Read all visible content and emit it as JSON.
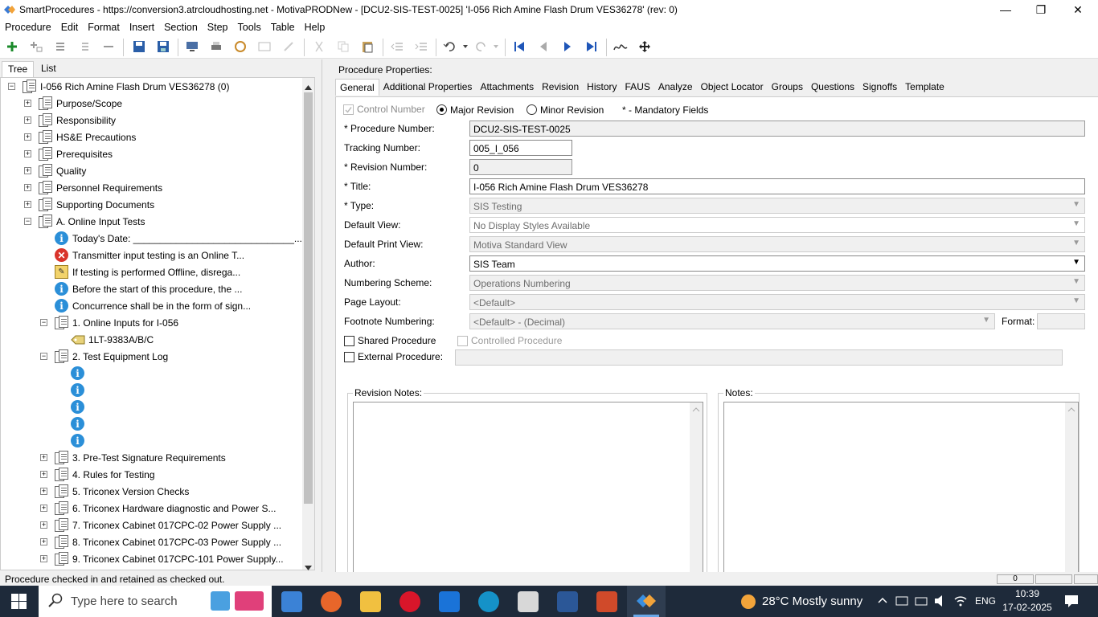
{
  "window": {
    "title": "SmartProcedures - https://conversion3.atrcloudhosting.net - MotivaPRODNew - [DCU2-SIS-TEST-0025] 'I-056 Rich Amine Flash Drum VES36278' (rev: 0)",
    "minimize": "—",
    "restore": "❐",
    "close": "✕"
  },
  "menu": [
    "Procedure",
    "Edit",
    "Format",
    "Insert",
    "Section",
    "Step",
    "Tools",
    "Table",
    "Help"
  ],
  "left_tabs": [
    "Tree",
    "List"
  ],
  "tree": {
    "root": "I-056 Rich Amine Flash Drum VES36278 (0)",
    "sections": [
      "Purpose/Scope",
      "Responsibility",
      "HS&E Precautions",
      "Prerequisites",
      "Quality",
      "Personnel Requirements",
      "Supporting Documents",
      "A. Online Input Tests"
    ],
    "online_children": [
      "Today's Date: ______________________________...",
      "Transmitter input testing is an Online T...",
      "If testing is performed Offline, disrega...",
      "Before the start of this procedure, the ...",
      "Concurrence shall be in the form of sign..."
    ],
    "sub1": "1. Online Inputs for I-056",
    "sub1_child": "1LT-9383A/B/C",
    "sub2": "2. Test Equipment Log",
    "later": [
      "3. Pre-Test Signature Requirements",
      "4. Rules for Testing",
      "5. Triconex Version Checks",
      "6. Triconex Hardware diagnostic and Power S...",
      "7. Triconex Cabinet 017CPC-02 Power Supply ...",
      "8. Triconex Cabinet 017CPC-03 Power Supply ...",
      "9. Triconex Cabinet 017CPC-101 Power Supply..."
    ],
    "expand_plus": "+",
    "expand_minus": "−",
    "info_glyph": "i",
    "err_glyph": "✕",
    "warn_glyph": "✎"
  },
  "props": {
    "heading": "Procedure Properties:",
    "tabs": [
      "General",
      "Additional Properties",
      "Attachments",
      "Revision",
      "History",
      "FAUS",
      "Analyze",
      "Object Locator",
      "Groups",
      "Questions",
      "Signoffs",
      "Template"
    ],
    "control_number": "Control Number",
    "major_revision": "Major Revision",
    "minor_revision": "Minor Revision",
    "mandatory": "* - Mandatory Fields",
    "procedure_number_label": "* Procedure Number:",
    "procedure_number": "DCU2-SIS-TEST-0025",
    "tracking_number_label": "Tracking Number:",
    "tracking_number": "005_I_056",
    "revision_number_label": "* Revision Number:",
    "revision_number": "0",
    "title_label": "* Title:",
    "title": "I-056 Rich Amine Flash Drum VES36278",
    "type_label": "* Type:",
    "type": "SIS Testing",
    "default_view_label": "Default View:",
    "default_view": "No Display Styles Available",
    "default_print_view_label": "Default Print View:",
    "default_print_view": "Motiva Standard View",
    "author_label": "Author:",
    "author": "SIS Team",
    "numbering_scheme_label": "Numbering Scheme:",
    "numbering_scheme": "Operations Numbering",
    "page_layout_label": "Page Layout:",
    "page_layout": "<Default>",
    "footnote_numbering_label": "Footnote Numbering:",
    "footnote_numbering": "<Default> - (Decimal)",
    "format_label": "Format:",
    "shared_procedure": "Shared Procedure",
    "controlled_procedure": "Controlled Procedure",
    "external_procedure": "External Procedure:",
    "revision_notes": "Revision Notes:",
    "notes": "Notes:"
  },
  "status": {
    "text": "Procedure checked in and retained as checked out.",
    "panel1": "0"
  },
  "taskbar": {
    "search_placeholder": "Type here to search",
    "weather": "28°C  Mostly sunny",
    "lang": "ENG",
    "time": "10:39",
    "date": "17-02-2025"
  }
}
